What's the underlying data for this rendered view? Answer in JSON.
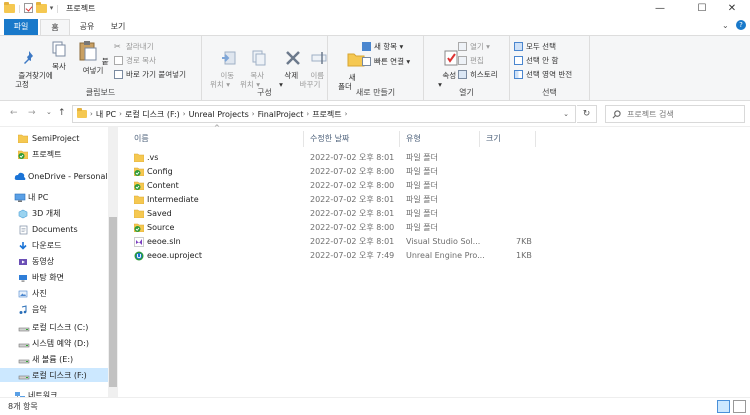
{
  "window": {
    "title": "프로젝트"
  },
  "tabs": [
    {
      "label": "파일"
    },
    {
      "label": "홈"
    },
    {
      "label": "공유"
    },
    {
      "label": "보기"
    }
  ],
  "ribbon": {
    "clipboard": {
      "label": "클립보드",
      "pin": "즐겨찾기에\n고정",
      "copy": "복사",
      "paste": "붙여넣기",
      "cut": "잘라내기",
      "copy_path": "경로 복사",
      "paste_shortcut": "바로 가기 붙여넣기"
    },
    "organize": {
      "label": "구성",
      "move_to": "이동\n위치 ▾",
      "copy_to": "복사\n위치 ▾",
      "delete": "삭제\n▾",
      "rename": "이름\n바꾸기"
    },
    "new": {
      "label": "새로 만들기",
      "new_folder": "새\n폴더",
      "new_item": "새 항목 ▾",
      "easy_access": "빠른 연결 ▾"
    },
    "open": {
      "label": "열기",
      "properties": "속성\n▾",
      "open": "열기 ▾",
      "edit": "편집",
      "history": "히스토리"
    },
    "select": {
      "label": "선택",
      "select_all": "모두 선택",
      "select_none": "선택 안 함",
      "invert": "선택 영역 반전"
    }
  },
  "address": {
    "parts": [
      "내 PC",
      "로컬 디스크 (F:)",
      "Unreal Projects",
      "FinalProject",
      "프로젝트"
    ],
    "search_placeholder": "프로젝트 검색"
  },
  "nav_pane": {
    "items": [
      {
        "label": "SemiProject",
        "icon": "folder"
      },
      {
        "label": "프로젝트",
        "icon": "folder-sync"
      },
      {
        "label": "OneDrive - Personal",
        "icon": "cloud"
      },
      {
        "label": "내 PC",
        "icon": "pc"
      },
      {
        "label": "3D 개체",
        "icon": "cube"
      },
      {
        "label": "Documents",
        "icon": "documents"
      },
      {
        "label": "다운로드",
        "icon": "download"
      },
      {
        "label": "동영상",
        "icon": "video"
      },
      {
        "label": "바탕 화면",
        "icon": "desktop"
      },
      {
        "label": "사진",
        "icon": "pictures"
      },
      {
        "label": "음악",
        "icon": "music"
      },
      {
        "label": "로컬 디스크 (C:)",
        "icon": "drive"
      },
      {
        "label": "시스템 예약 (D:)",
        "icon": "drive"
      },
      {
        "label": "새 볼륨 (E:)",
        "icon": "drive"
      },
      {
        "label": "로컬 디스크 (F:)",
        "icon": "drive",
        "selected": true
      },
      {
        "label": "네트워크",
        "icon": "network"
      }
    ]
  },
  "columns": {
    "name": "이름",
    "modified": "수정한 날짜",
    "type": "유형",
    "size": "크기"
  },
  "files": [
    {
      "name": ".vs",
      "modified": "2022-07-02 오후 8:01",
      "type": "파일 폴더",
      "size": "",
      "icon": "folder"
    },
    {
      "name": "Config",
      "modified": "2022-07-02 오후 8:00",
      "type": "파일 폴더",
      "size": "",
      "icon": "folder-sync"
    },
    {
      "name": "Content",
      "modified": "2022-07-02 오후 8:00",
      "type": "파일 폴더",
      "size": "",
      "icon": "folder-sync"
    },
    {
      "name": "Intermediate",
      "modified": "2022-07-02 오후 8:01",
      "type": "파일 폴더",
      "size": "",
      "icon": "folder"
    },
    {
      "name": "Saved",
      "modified": "2022-07-02 오후 8:01",
      "type": "파일 폴더",
      "size": "",
      "icon": "folder"
    },
    {
      "name": "Source",
      "modified": "2022-07-02 오후 8:00",
      "type": "파일 폴더",
      "size": "",
      "icon": "folder-sync"
    },
    {
      "name": "eeoe.sln",
      "modified": "2022-07-02 오후 8:01",
      "type": "Visual Studio Sol...",
      "size": "7KB",
      "icon": "vs-solution"
    },
    {
      "name": "eeoe.uproject",
      "modified": "2022-07-02 오후 7:49",
      "type": "Unreal Engine Pro...",
      "size": "1KB",
      "icon": "unreal-project"
    }
  ],
  "status": {
    "item_count": "8개 항목"
  }
}
